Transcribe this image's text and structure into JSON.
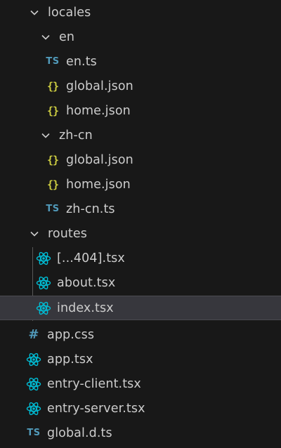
{
  "explorer": {
    "items": [
      {
        "label": "locales"
      },
      {
        "label": "en"
      },
      {
        "label": "en.ts",
        "icon": "TS"
      },
      {
        "label": "global.json",
        "icon": "{}"
      },
      {
        "label": "home.json",
        "icon": "{}"
      },
      {
        "label": "zh-cn"
      },
      {
        "label": "global.json",
        "icon": "{}"
      },
      {
        "label": "home.json",
        "icon": "{}"
      },
      {
        "label": "zh-cn.ts",
        "icon": "TS"
      },
      {
        "label": "routes"
      },
      {
        "label": "[...404].tsx"
      },
      {
        "label": "about.tsx"
      },
      {
        "label": "index.tsx"
      },
      {
        "label": "app.css",
        "icon": "#"
      },
      {
        "label": "app.tsx"
      },
      {
        "label": "entry-client.tsx"
      },
      {
        "label": "entry-server.tsx"
      },
      {
        "label": "global.d.ts",
        "icon": "TS"
      }
    ]
  },
  "colors": {
    "background": "#181818",
    "selected_row": "#37373d",
    "text": "#cccccc",
    "ts_icon": "#519aba",
    "json_icon": "#cbcb41",
    "react_icon": "#00bcd4",
    "indent_guide": "#585858"
  }
}
